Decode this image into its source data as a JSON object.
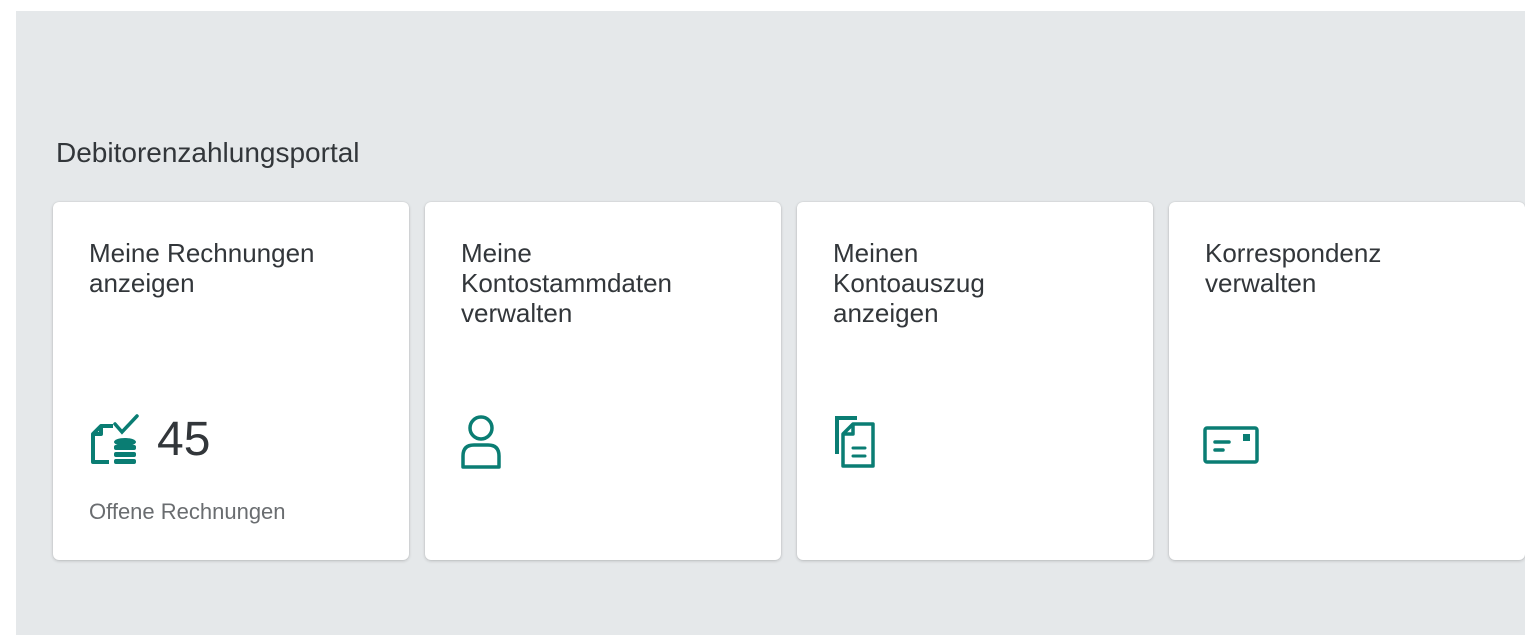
{
  "group": {
    "title": "Debitorenzahlungsportal"
  },
  "tiles": [
    {
      "title_lines": [
        "Meine Rechnungen",
        "anzeigen"
      ],
      "icon": "invoice-stack-check-icon",
      "kpi_value": "45",
      "footer": "Offene Rechnungen"
    },
    {
      "title_lines": [
        "Meine",
        "Kontostammdaten",
        "verwalten"
      ],
      "icon": "person-icon"
    },
    {
      "title_lines": [
        "Meinen",
        "Kontoauszug",
        "anzeigen"
      ],
      "icon": "documents-icon"
    },
    {
      "title_lines": [
        "Korrespondenz",
        "verwalten"
      ],
      "icon": "envelope-card-icon"
    }
  ],
  "colors": {
    "icon": "#0a7d73",
    "background": "#e5e8ea",
    "tile": "#ffffff",
    "text": "#32363a",
    "subtext": "#6a6d70"
  }
}
